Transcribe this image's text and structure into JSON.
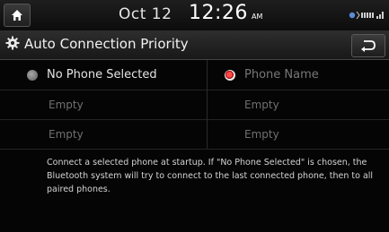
{
  "status": {
    "date": "Oct 12",
    "time": "12:26",
    "ampm": "AM"
  },
  "header": {
    "title": "Auto Connection Priority"
  },
  "list": {
    "left": {
      "items": [
        "No Phone Selected",
        "Empty",
        "Empty"
      ]
    },
    "right": {
      "items": [
        "Phone Name",
        "Empty",
        "Empty"
      ]
    }
  },
  "description": "Connect a selected phone at startup. If \"No Phone Selected\" is chosen, the Bluetooth system will try to connect to the last connected phone, then to all paired phones.",
  "colors": {
    "accent": "#e02020",
    "background": "#050505"
  }
}
